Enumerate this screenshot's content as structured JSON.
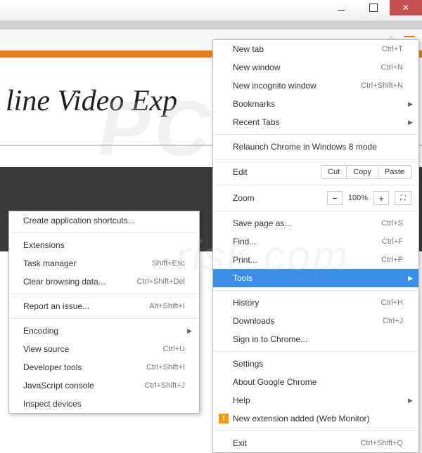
{
  "window": {
    "title": ""
  },
  "page": {
    "headline": "line Video Exp"
  },
  "watermark": {
    "top": "PC",
    "bottom": "risk.com"
  },
  "mainMenu": {
    "newTab": {
      "label": "New tab",
      "shortcut": "Ctrl+T"
    },
    "newWindow": {
      "label": "New window",
      "shortcut": "Ctrl+N"
    },
    "newIncognito": {
      "label": "New incognito window",
      "shortcut": "Ctrl+Shift+N"
    },
    "bookmarks": {
      "label": "Bookmarks"
    },
    "recentTabs": {
      "label": "Recent Tabs"
    },
    "relaunch": {
      "label": "Relaunch Chrome in Windows 8 mode"
    },
    "edit": {
      "label": "Edit",
      "cut": "Cut",
      "copy": "Copy",
      "paste": "Paste"
    },
    "zoom": {
      "label": "Zoom",
      "value": "100%"
    },
    "savePage": {
      "label": "Save page as...",
      "shortcut": "Ctrl+S"
    },
    "find": {
      "label": "Find...",
      "shortcut": "Ctrl+F"
    },
    "print": {
      "label": "Print...",
      "shortcut": "Ctrl+P"
    },
    "tools": {
      "label": "Tools"
    },
    "history": {
      "label": "History",
      "shortcut": "Ctrl+H"
    },
    "downloads": {
      "label": "Downloads",
      "shortcut": "Ctrl+J"
    },
    "signIn": {
      "label": "Sign in to Chrome..."
    },
    "settings": {
      "label": "Settings"
    },
    "about": {
      "label": "About Google Chrome"
    },
    "help": {
      "label": "Help"
    },
    "newExt": {
      "label": "New extension added (Web Monitor)"
    },
    "exit": {
      "label": "Exit",
      "shortcut": "Ctrl+Shift+Q"
    }
  },
  "subMenu": {
    "createShortcuts": {
      "label": "Create application shortcuts..."
    },
    "extensions": {
      "label": "Extensions"
    },
    "taskManager": {
      "label": "Task manager",
      "shortcut": "Shift+Esc"
    },
    "clearData": {
      "label": "Clear browsing data...",
      "shortcut": "Ctrl+Shift+Del"
    },
    "reportIssue": {
      "label": "Report an issue...",
      "shortcut": "Alt+Shift+I"
    },
    "encoding": {
      "label": "Encoding"
    },
    "viewSource": {
      "label": "View source",
      "shortcut": "Ctrl+U"
    },
    "devTools": {
      "label": "Developer tools",
      "shortcut": "Ctrl+Shift+I"
    },
    "jsConsole": {
      "label": "JavaScript console",
      "shortcut": "Ctrl+Shift+J"
    },
    "inspectDevices": {
      "label": "Inspect devices"
    }
  }
}
